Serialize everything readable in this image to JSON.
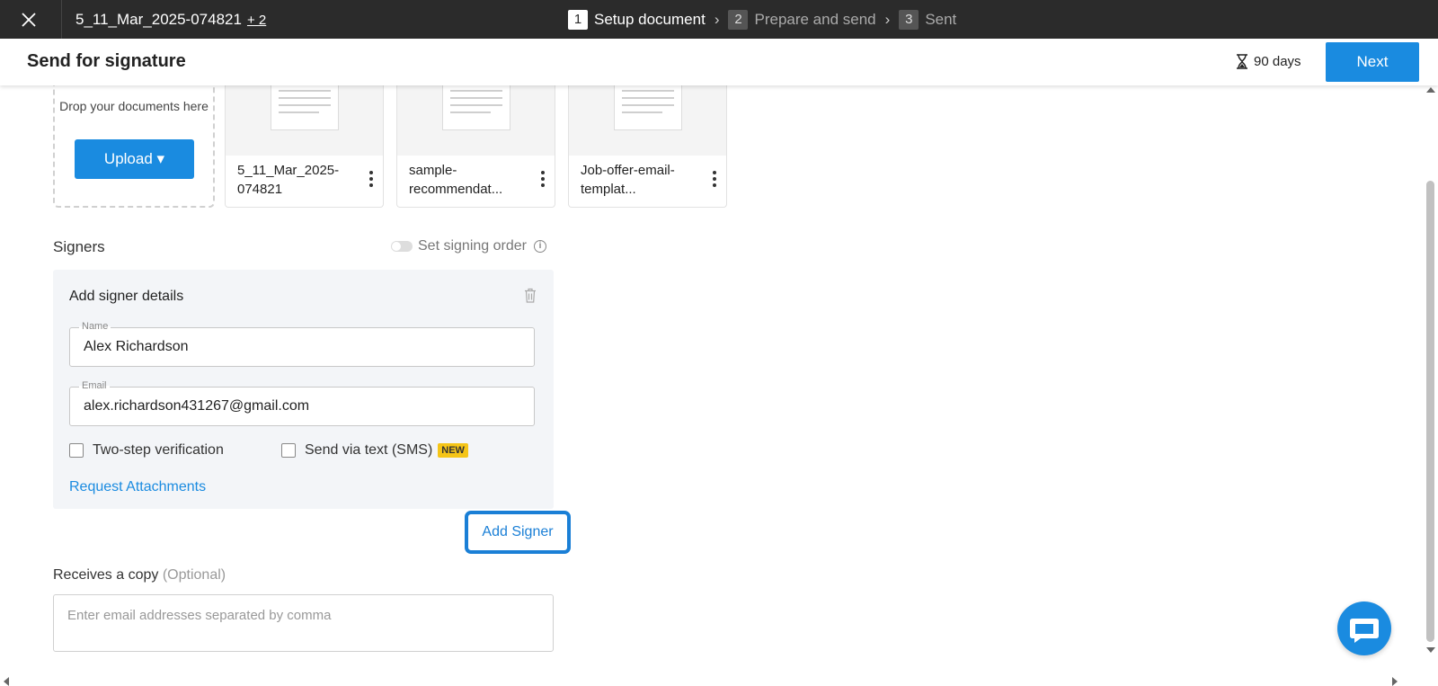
{
  "topbar": {
    "doc_name": "5_11_Mar_2025-074821",
    "more_docs": "+ 2",
    "steps": [
      {
        "num": "1",
        "label": "Setup document",
        "active": true
      },
      {
        "num": "2",
        "label": "Prepare and send",
        "active": false
      },
      {
        "num": "3",
        "label": "Sent",
        "active": false
      }
    ]
  },
  "header": {
    "title": "Send for signature",
    "expiry": "90 days",
    "next_label": "Next"
  },
  "upload": {
    "drop_text": "Drop your documents here",
    "upload_label": "Upload ▾"
  },
  "documents": [
    {
      "name": "5_11_Mar_2025-074821"
    },
    {
      "name": "sample-recommendat..."
    },
    {
      "name": "Job-offer-email-templat..."
    }
  ],
  "signers": {
    "label": "Signers",
    "signing_order_label": "Set signing order",
    "box_title": "Add signer details",
    "name_label": "Name",
    "name_value": "Alex Richardson",
    "email_label": "Email",
    "email_value": "alex.richardson431267@gmail.com",
    "two_step_label": "Two-step verification",
    "sms_label": "Send via text (SMS)",
    "new_badge": "NEW",
    "request_attachments": "Request Attachments",
    "add_signer_label": "Add Signer"
  },
  "copy": {
    "label": "Receives a copy",
    "optional": "(Optional)",
    "placeholder": "Enter email addresses separated by comma"
  },
  "colors": {
    "primary": "#1a8be0",
    "topbar": "#2b2b2b",
    "badge": "#f5c518"
  }
}
